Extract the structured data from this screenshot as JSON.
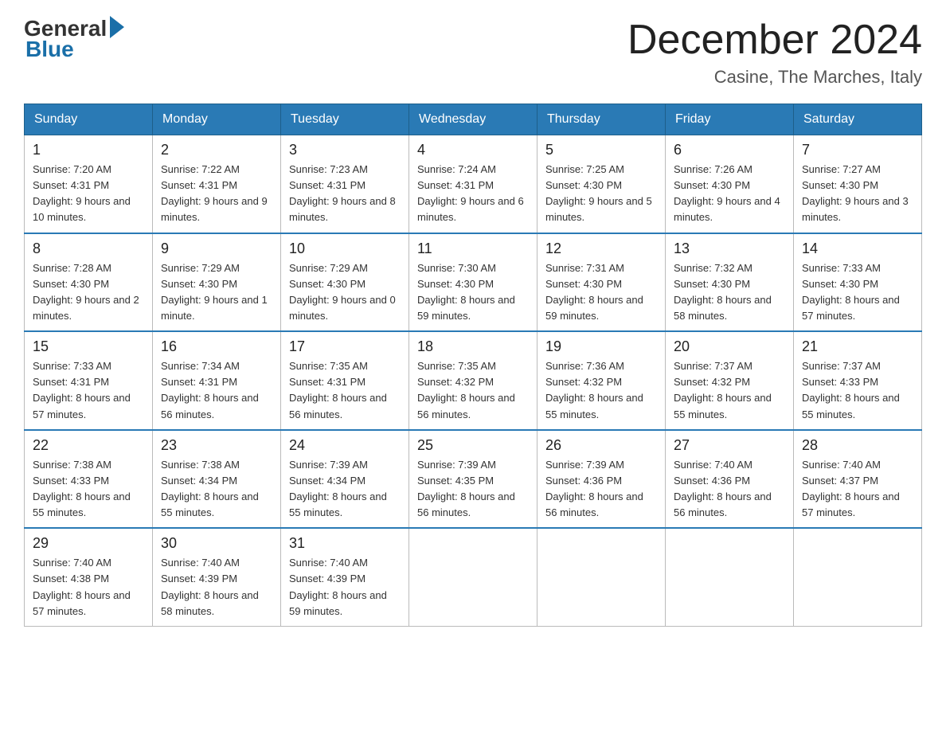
{
  "header": {
    "logo_general": "General",
    "logo_blue": "Blue",
    "month_title": "December 2024",
    "location": "Casine, The Marches, Italy"
  },
  "days_of_week": [
    "Sunday",
    "Monday",
    "Tuesday",
    "Wednesday",
    "Thursday",
    "Friday",
    "Saturday"
  ],
  "weeks": [
    [
      {
        "day": "1",
        "sunrise": "7:20 AM",
        "sunset": "4:31 PM",
        "daylight": "9 hours and 10 minutes."
      },
      {
        "day": "2",
        "sunrise": "7:22 AM",
        "sunset": "4:31 PM",
        "daylight": "9 hours and 9 minutes."
      },
      {
        "day": "3",
        "sunrise": "7:23 AM",
        "sunset": "4:31 PM",
        "daylight": "9 hours and 8 minutes."
      },
      {
        "day": "4",
        "sunrise": "7:24 AM",
        "sunset": "4:31 PM",
        "daylight": "9 hours and 6 minutes."
      },
      {
        "day": "5",
        "sunrise": "7:25 AM",
        "sunset": "4:30 PM",
        "daylight": "9 hours and 5 minutes."
      },
      {
        "day": "6",
        "sunrise": "7:26 AM",
        "sunset": "4:30 PM",
        "daylight": "9 hours and 4 minutes."
      },
      {
        "day": "7",
        "sunrise": "7:27 AM",
        "sunset": "4:30 PM",
        "daylight": "9 hours and 3 minutes."
      }
    ],
    [
      {
        "day": "8",
        "sunrise": "7:28 AM",
        "sunset": "4:30 PM",
        "daylight": "9 hours and 2 minutes."
      },
      {
        "day": "9",
        "sunrise": "7:29 AM",
        "sunset": "4:30 PM",
        "daylight": "9 hours and 1 minute."
      },
      {
        "day": "10",
        "sunrise": "7:29 AM",
        "sunset": "4:30 PM",
        "daylight": "9 hours and 0 minutes."
      },
      {
        "day": "11",
        "sunrise": "7:30 AM",
        "sunset": "4:30 PM",
        "daylight": "8 hours and 59 minutes."
      },
      {
        "day": "12",
        "sunrise": "7:31 AM",
        "sunset": "4:30 PM",
        "daylight": "8 hours and 59 minutes."
      },
      {
        "day": "13",
        "sunrise": "7:32 AM",
        "sunset": "4:30 PM",
        "daylight": "8 hours and 58 minutes."
      },
      {
        "day": "14",
        "sunrise": "7:33 AM",
        "sunset": "4:30 PM",
        "daylight": "8 hours and 57 minutes."
      }
    ],
    [
      {
        "day": "15",
        "sunrise": "7:33 AM",
        "sunset": "4:31 PM",
        "daylight": "8 hours and 57 minutes."
      },
      {
        "day": "16",
        "sunrise": "7:34 AM",
        "sunset": "4:31 PM",
        "daylight": "8 hours and 56 minutes."
      },
      {
        "day": "17",
        "sunrise": "7:35 AM",
        "sunset": "4:31 PM",
        "daylight": "8 hours and 56 minutes."
      },
      {
        "day": "18",
        "sunrise": "7:35 AM",
        "sunset": "4:32 PM",
        "daylight": "8 hours and 56 minutes."
      },
      {
        "day": "19",
        "sunrise": "7:36 AM",
        "sunset": "4:32 PM",
        "daylight": "8 hours and 55 minutes."
      },
      {
        "day": "20",
        "sunrise": "7:37 AM",
        "sunset": "4:32 PM",
        "daylight": "8 hours and 55 minutes."
      },
      {
        "day": "21",
        "sunrise": "7:37 AM",
        "sunset": "4:33 PM",
        "daylight": "8 hours and 55 minutes."
      }
    ],
    [
      {
        "day": "22",
        "sunrise": "7:38 AM",
        "sunset": "4:33 PM",
        "daylight": "8 hours and 55 minutes."
      },
      {
        "day": "23",
        "sunrise": "7:38 AM",
        "sunset": "4:34 PM",
        "daylight": "8 hours and 55 minutes."
      },
      {
        "day": "24",
        "sunrise": "7:39 AM",
        "sunset": "4:34 PM",
        "daylight": "8 hours and 55 minutes."
      },
      {
        "day": "25",
        "sunrise": "7:39 AM",
        "sunset": "4:35 PM",
        "daylight": "8 hours and 56 minutes."
      },
      {
        "day": "26",
        "sunrise": "7:39 AM",
        "sunset": "4:36 PM",
        "daylight": "8 hours and 56 minutes."
      },
      {
        "day": "27",
        "sunrise": "7:40 AM",
        "sunset": "4:36 PM",
        "daylight": "8 hours and 56 minutes."
      },
      {
        "day": "28",
        "sunrise": "7:40 AM",
        "sunset": "4:37 PM",
        "daylight": "8 hours and 57 minutes."
      }
    ],
    [
      {
        "day": "29",
        "sunrise": "7:40 AM",
        "sunset": "4:38 PM",
        "daylight": "8 hours and 57 minutes."
      },
      {
        "day": "30",
        "sunrise": "7:40 AM",
        "sunset": "4:39 PM",
        "daylight": "8 hours and 58 minutes."
      },
      {
        "day": "31",
        "sunrise": "7:40 AM",
        "sunset": "4:39 PM",
        "daylight": "8 hours and 59 minutes."
      },
      null,
      null,
      null,
      null
    ]
  ],
  "labels": {
    "sunrise": "Sunrise:",
    "sunset": "Sunset:",
    "daylight": "Daylight:"
  }
}
